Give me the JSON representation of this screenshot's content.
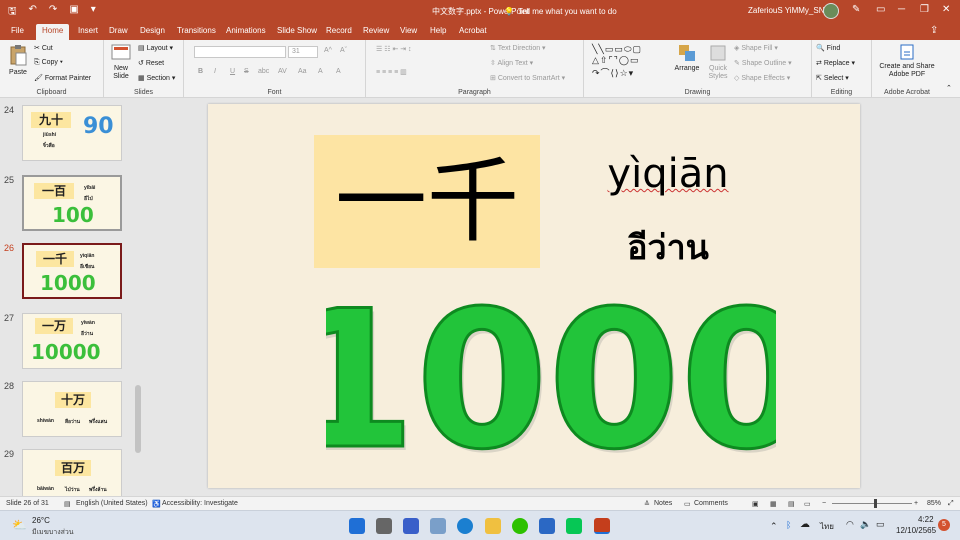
{
  "titlebar": {
    "file_title": "中文数字.pptx  -  PowerPoint",
    "tell_me": "Tell me what you want to do",
    "user": "ZaferiouS YiMMy_SN",
    "minimize": "─",
    "restore": "❐",
    "close": "✕"
  },
  "tabs": [
    "File",
    "Home",
    "Insert",
    "Draw",
    "Design",
    "Transitions",
    "Animations",
    "Slide Show",
    "Record",
    "Review",
    "View",
    "Help",
    "Acrobat"
  ],
  "ribbon": {
    "clipboard": {
      "paste": "Paste",
      "cut": "Cut",
      "copy": "Copy",
      "format_painter": "Format Painter",
      "label": "Clipboard"
    },
    "slides": {
      "new_slide": "New Slide",
      "layout": "Layout",
      "reset": "Reset",
      "section": "Section",
      "label": "Slides"
    },
    "font": {
      "size": "31",
      "label": "Font",
      "buttons": [
        "B",
        "I",
        "U",
        "S",
        "abc",
        "AV",
        "Aa",
        "A",
        "A"
      ]
    },
    "paragraph": {
      "text_direction": "Text Direction",
      "align_text": "Align Text",
      "convert_smartart": "Convert to SmartArt",
      "label": "Paragraph"
    },
    "drawing": {
      "arrange": "Arrange",
      "quick_styles": "Quick Styles",
      "shape_fill": "Shape Fill",
      "shape_outline": "Shape Outline",
      "shape_effects": "Shape Effects",
      "label": "Drawing"
    },
    "editing": {
      "find": "Find",
      "replace": "Replace",
      "select": "Select",
      "label": "Editing"
    },
    "acrobat": {
      "create_share": "Create and Share Adobe PDF",
      "label": "Adobe Acrobat"
    }
  },
  "thumbnails": [
    {
      "num": "24",
      "hanzi": "九十",
      "pinyin": "jiǔshí",
      "thai": "จิ๋วสือ",
      "number": "90",
      "current": false
    },
    {
      "num": "25",
      "hanzi": "一百",
      "pinyin": "yībǎi",
      "thai": "อีไป่",
      "number": "100",
      "current": false
    },
    {
      "num": "26",
      "hanzi": "一千",
      "pinyin": "yìqiān",
      "thai": "อีเชียน",
      "number": "1000",
      "current": true
    },
    {
      "num": "27",
      "hanzi": "一万",
      "pinyin": "yīwàn",
      "thai": "อีว่าน",
      "number": "10000",
      "current": false
    },
    {
      "num": "28",
      "hanzi": "十万",
      "pinyin": "shíwàn",
      "thai": "สือว่าน",
      "extra": "พรึ่งแสน",
      "current": false
    },
    {
      "num": "29",
      "hanzi": "百万",
      "pinyin": "bǎiwàn",
      "thai": "ไป่ว่าน",
      "extra": "พรึ่งล้าน",
      "current": false
    }
  ],
  "slide": {
    "hanzi": "一千",
    "pinyin": "yìqiān",
    "thai": "อีว่าน",
    "number": "1000",
    "colors": {
      "box": "#fde4a3",
      "one": "#f7a21b",
      "zero": "#22c43a"
    }
  },
  "status": {
    "slide_info": "Slide 26 of 31",
    "language": "English (United States)",
    "accessibility": "Accessibility: Investigate",
    "notes": "Notes",
    "comments": "Comments",
    "zoom": "85%"
  },
  "taskbar": {
    "temp": "26°C",
    "weather": "มีเมฆบางส่วน",
    "lang": "ไทย",
    "time": "4:22",
    "date": "12/10/2565",
    "badge": "5"
  }
}
